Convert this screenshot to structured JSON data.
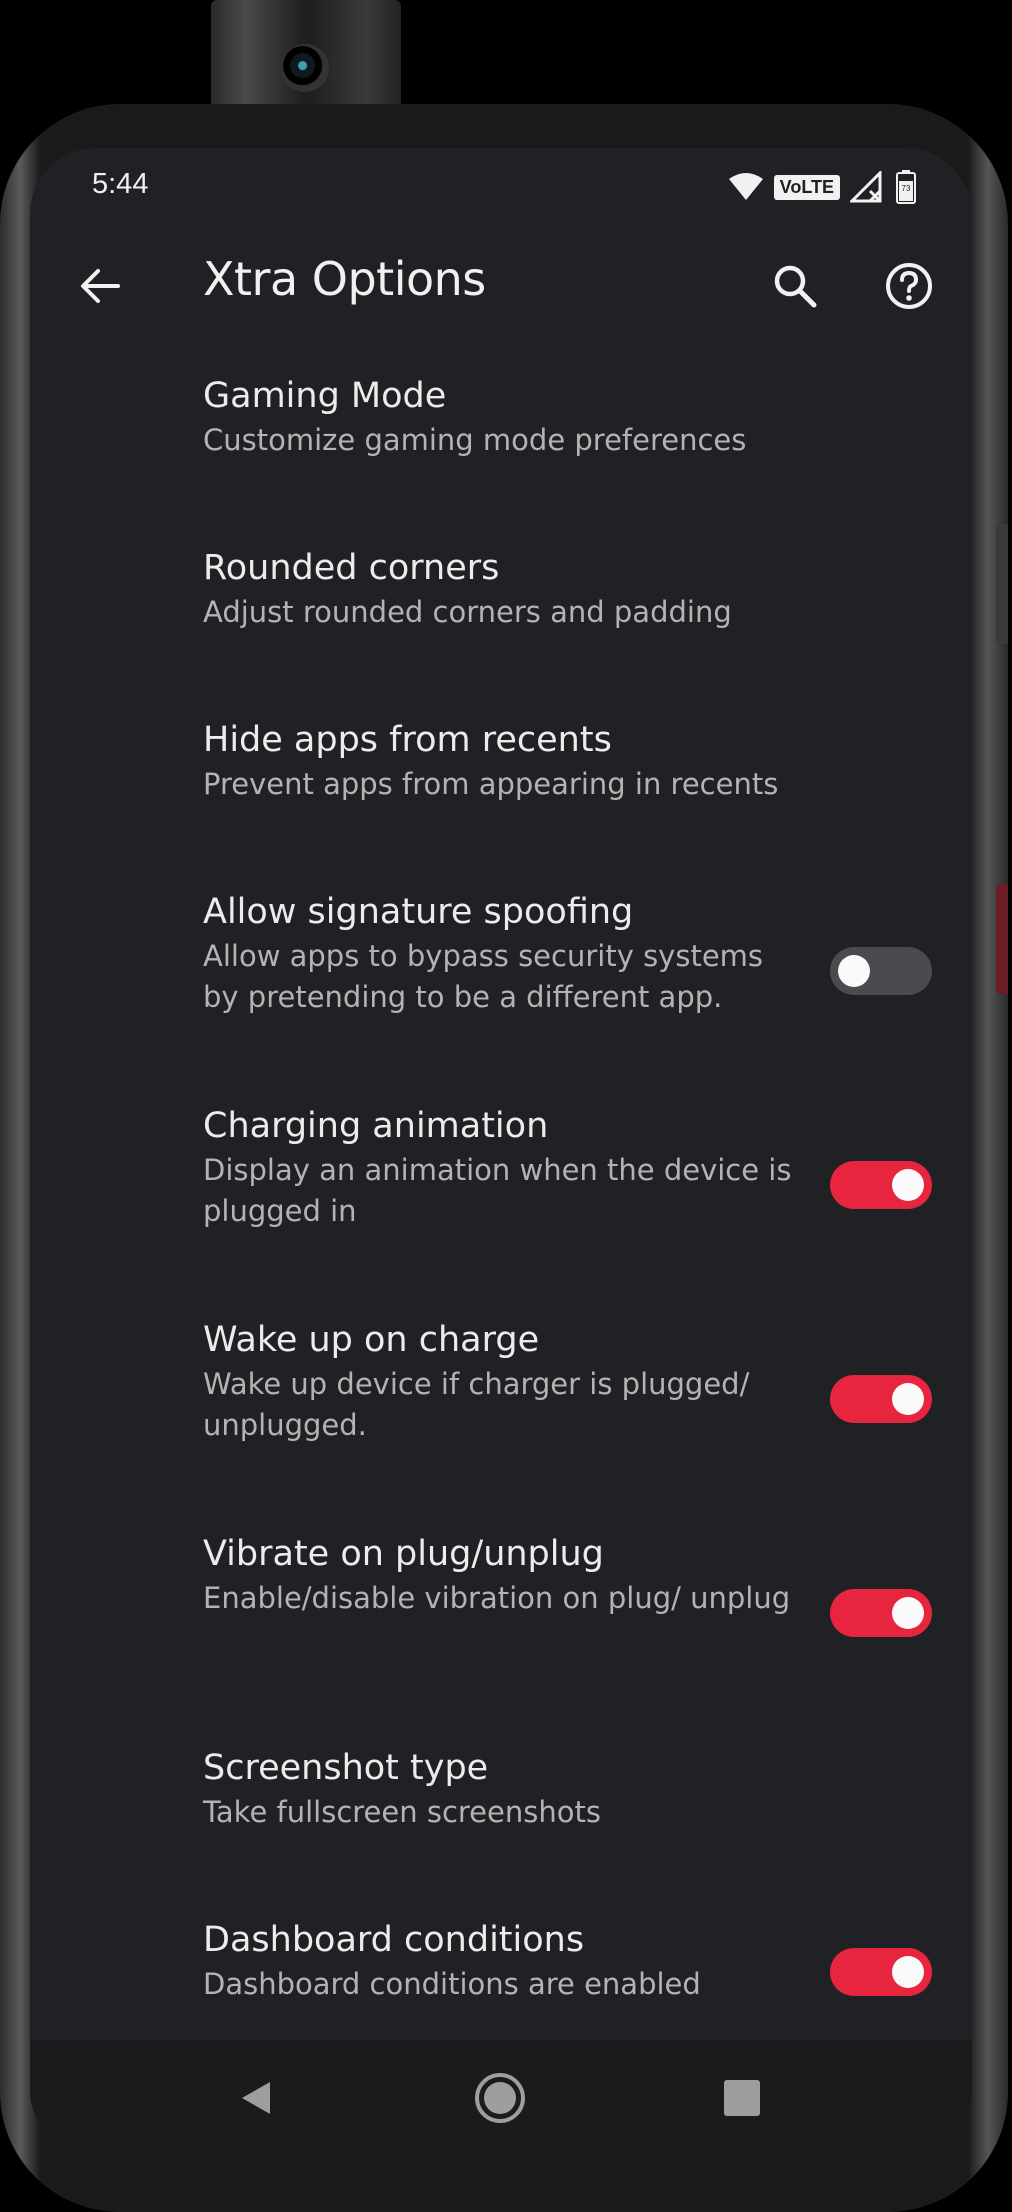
{
  "status_bar": {
    "time": "5:44",
    "network_badge": "VoLTE",
    "battery_level": "73",
    "icons": [
      "wifi-icon",
      "signal-icon",
      "battery-icon"
    ]
  },
  "app_bar": {
    "title": "Xtra Options",
    "icons": [
      "back-arrow-icon",
      "search-icon",
      "help-icon"
    ]
  },
  "preferences": [
    {
      "title": "Gaming Mode",
      "summary": "Customize gaming mode preferences"
    },
    {
      "title": "Rounded corners",
      "summary": "Adjust rounded corners and padding"
    },
    {
      "title": "Hide apps from recents",
      "summary": "Prevent apps from appearing in recents"
    },
    {
      "title": "Allow signature spoofing",
      "summary": "Allow apps to bypass security systems by pretending to be a different app.",
      "switch": false
    },
    {
      "title": "Charging animation",
      "summary": "Display an animation when the device is plugged in",
      "switch": true
    },
    {
      "title": "Wake up on charge",
      "summary": "Wake up device if charger is plugged/ unplugged.",
      "switch": true
    },
    {
      "title": "Vibrate on plug/unplug",
      "summary": "Enable/disable vibration on plug/ unplug",
      "switch": true
    },
    {
      "title": "Screenshot type",
      "summary": "Take fullscreen screenshots"
    },
    {
      "title": "Dashboard conditions",
      "summary": "Dashboard conditions are enabled",
      "switch": true
    }
  ],
  "nav_bar": {
    "icons": [
      "nav-back-icon",
      "nav-home-icon",
      "nav-recents-icon"
    ]
  },
  "colors": {
    "background": "#202124",
    "accent": "#e8253e",
    "switch_off": "#4a4b4e",
    "primary_text": "#ececec",
    "secondary_text": "#b3b3b3"
  }
}
